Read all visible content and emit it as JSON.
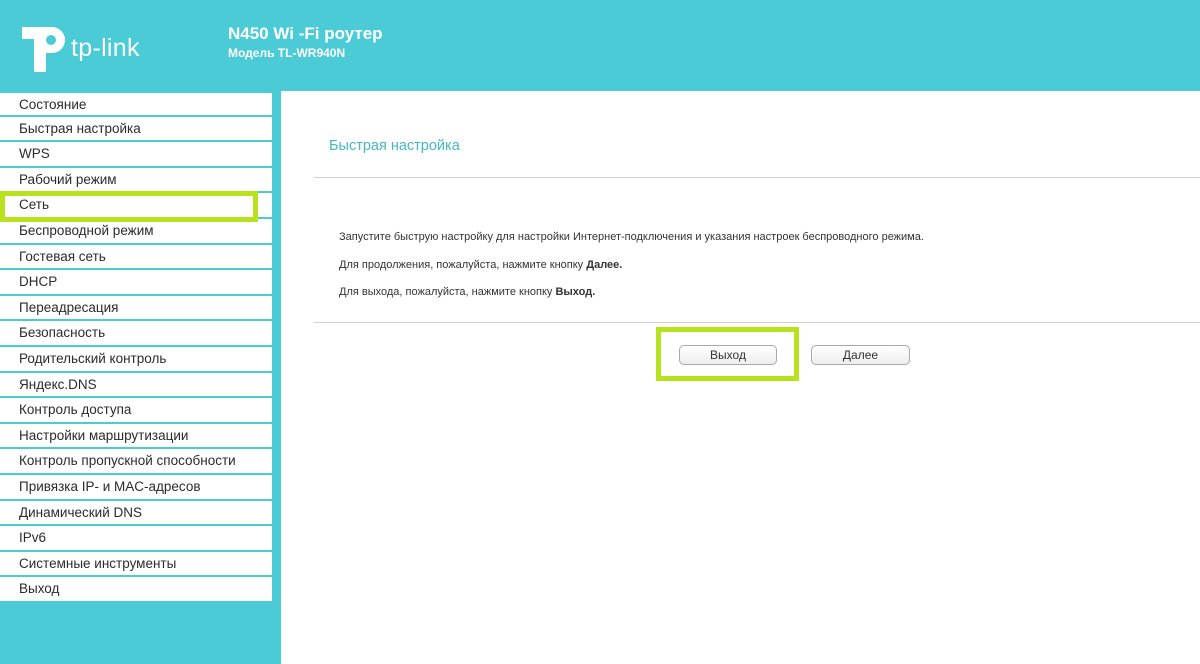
{
  "header": {
    "brand": "tp-link",
    "product_title": "N450 Wi -Fi роутер",
    "model": "Модель TL-WR940N"
  },
  "sidebar": {
    "items": [
      {
        "label": "Состояние"
      },
      {
        "label": "Быстрая настройка"
      },
      {
        "label": "WPS"
      },
      {
        "label": "Рабочий режим"
      },
      {
        "label": "Сеть"
      },
      {
        "label": "Беспроводной режим"
      },
      {
        "label": "Гостевая сеть"
      },
      {
        "label": "DHCP"
      },
      {
        "label": "Переадресация"
      },
      {
        "label": "Безопасность"
      },
      {
        "label": "Родительский контроль"
      },
      {
        "label": "Яндекс.DNS"
      },
      {
        "label": "Контроль доступа"
      },
      {
        "label": "Настройки маршрутизации"
      },
      {
        "label": "Контроль пропускной способности"
      },
      {
        "label": "Привязка IP- и MAC-адресов"
      },
      {
        "label": "Динамический DNS"
      },
      {
        "label": "IPv6"
      },
      {
        "label": "Системные инструменты"
      },
      {
        "label": "Выход"
      }
    ]
  },
  "main": {
    "title": "Быстрая настройка",
    "line1": "Запустите быструю настройку для настройки Интернет-подключения и указания настроек беспроводного режима.",
    "line2_prefix": "Для продолжения, пожалуйста, нажмите кнопку ",
    "line2_bold": "Далее.",
    "line3_prefix": "Для выхода, пожалуйста, нажмите кнопку ",
    "line3_bold": "Выход.",
    "exit_button": "Выход",
    "next_button": "Далее"
  },
  "colors": {
    "brand_teal": "#4acbd6",
    "highlight_green": "#b8e21e",
    "title_teal": "#46b6c6"
  }
}
